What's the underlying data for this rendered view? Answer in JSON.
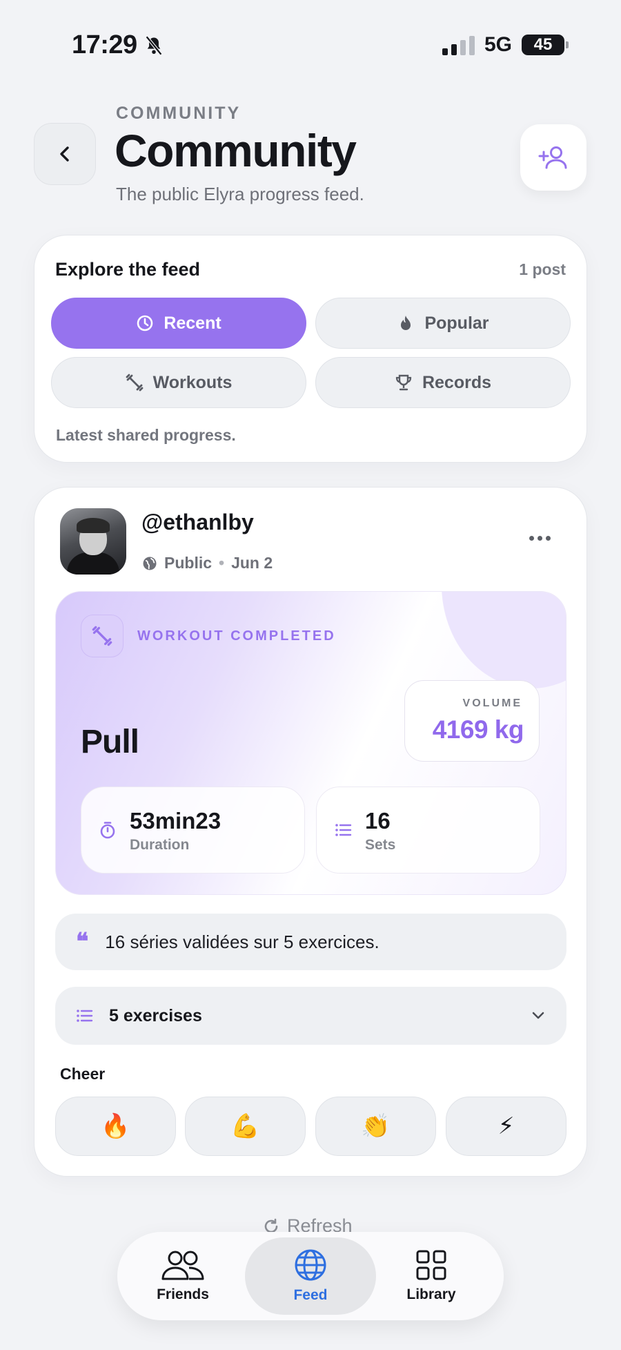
{
  "status_bar": {
    "time": "17:29",
    "network": "5G",
    "battery": "45"
  },
  "header": {
    "eyebrow": "COMMUNITY",
    "title": "Community",
    "subtitle": "The public Elyra progress feed."
  },
  "explore": {
    "title": "Explore the feed",
    "count": "1 post",
    "filters": [
      {
        "label": "Recent",
        "icon": "clock-icon",
        "active": true
      },
      {
        "label": "Popular",
        "icon": "flame-icon",
        "active": false
      },
      {
        "label": "Workouts",
        "icon": "dumbbell-icon",
        "active": false
      },
      {
        "label": "Records",
        "icon": "trophy-icon",
        "active": false
      }
    ],
    "note": "Latest shared progress."
  },
  "post": {
    "username": "@ethanlby",
    "visibility": "Public",
    "date": "Jun 2",
    "workout": {
      "label": "WORKOUT COMPLETED",
      "name": "Pull",
      "volume_label": "VOLUME",
      "volume_value": "4169 kg",
      "stats": [
        {
          "value": "53min23",
          "label": "Duration",
          "icon": "timer-icon"
        },
        {
          "value": "16",
          "label": "Sets",
          "icon": "list-icon"
        }
      ]
    },
    "quote": "16 séries validées sur 5 exercices.",
    "exercises_label": "5 exercises",
    "cheer_title": "Cheer",
    "cheers": [
      "🔥",
      "💪",
      "👏",
      "⚡"
    ]
  },
  "refresh_label": "Refresh",
  "tabbar": {
    "tabs": [
      {
        "label": "Friends",
        "icon": "people-icon",
        "active": false
      },
      {
        "label": "Feed",
        "icon": "globe-icon",
        "active": true
      },
      {
        "label": "Library",
        "icon": "grid-icon",
        "active": false
      }
    ]
  },
  "colors": {
    "accent": "#9673ee",
    "active_tab": "#2e6fe0",
    "background": "#f2f3f6"
  }
}
